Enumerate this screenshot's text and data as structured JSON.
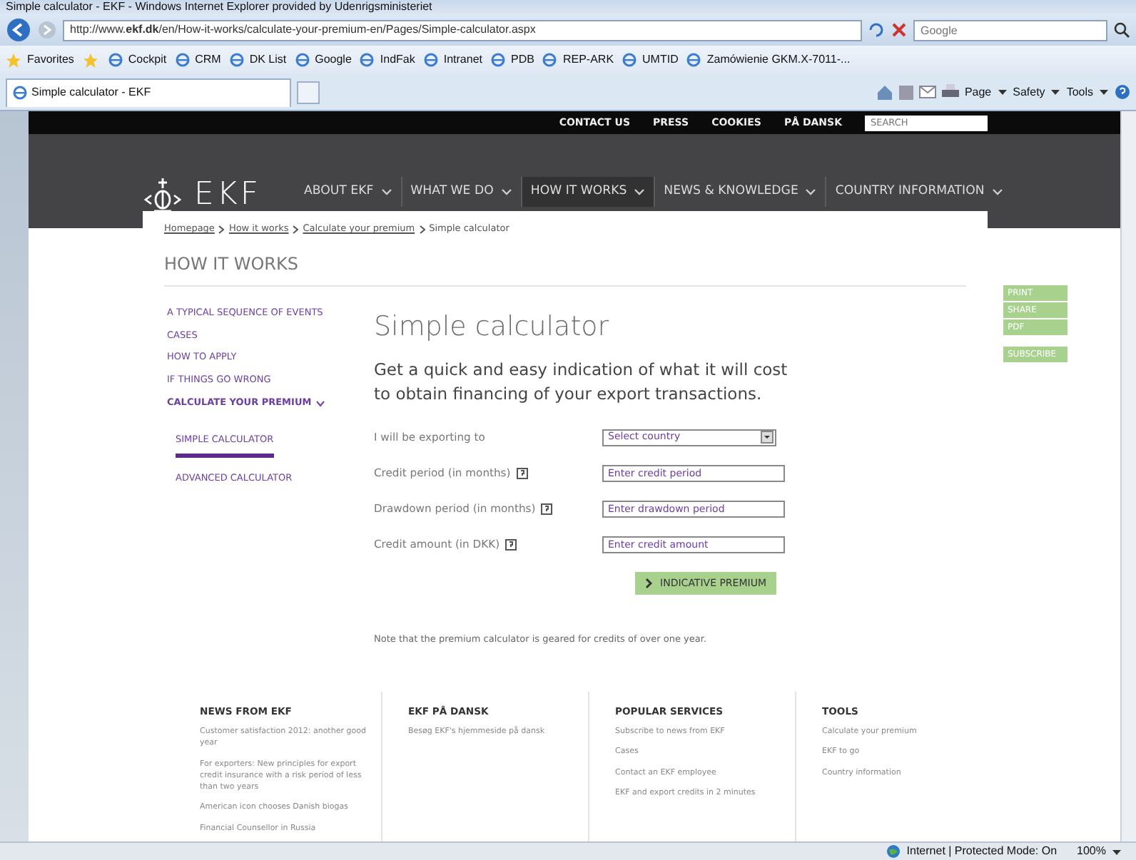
{
  "window": {
    "title": "Simple calculator - EKF - Windows Internet Explorer provided by Udenrigsministeriet"
  },
  "browser": {
    "address": "http://www.**ekf.dk**/en/How-it-works/calculate-your-premium-en/Pages/Simple-calculator.aspx",
    "search_placeholder": "Google",
    "favorites_label": "Favorites",
    "favorites": [
      {
        "label": "Cockpit"
      },
      {
        "label": "CRM"
      },
      {
        "label": "DK List"
      },
      {
        "label": "Google"
      },
      {
        "label": "IndFak"
      },
      {
        "label": "Intranet"
      },
      {
        "label": "PDB"
      },
      {
        "label": "REP-ARK"
      },
      {
        "label": "UMTID"
      },
      {
        "label": "Zamówienie GKM.X-7011-..."
      }
    ],
    "tab_title": "Simple calculator - EKF",
    "commands": [
      "Page",
      "Safety",
      "Tools"
    ]
  },
  "site": {
    "top_links": [
      "CONTACT US",
      "PRESS",
      "COOKIES",
      "PÅ DANSK"
    ],
    "search_placeholder": "SEARCH",
    "logo": "EKF",
    "nav": [
      {
        "label": "ABOUT EKF",
        "selected": false
      },
      {
        "label": "WHAT WE DO",
        "selected": false
      },
      {
        "label": "HOW IT WORKS",
        "selected": true
      },
      {
        "label": "NEWS & KNOWLEDGE",
        "selected": false
      },
      {
        "label": "COUNTRY INFORMATION",
        "selected": false
      }
    ],
    "breadcrumb": [
      {
        "label": "Homepage",
        "link": true
      },
      {
        "label": "How it works",
        "link": true
      },
      {
        "label": "Calculate your premium",
        "link": true
      },
      {
        "label": "Simple calculator",
        "link": false
      }
    ],
    "section_title": "HOW IT WORKS",
    "sidebar": [
      {
        "label": "A TYPICAL SEQUENCE OF EVENTS"
      },
      {
        "label": "CASES"
      },
      {
        "label": "HOW TO APPLY"
      },
      {
        "label": "IF THINGS GO WRONG"
      },
      {
        "label": "CALCULATE YOUR PREMIUM",
        "expanded": true,
        "children": [
          {
            "label": "SIMPLE CALCULATOR",
            "selected": true
          },
          {
            "label": "ADVANCED CALCULATOR",
            "selected": false
          }
        ]
      }
    ],
    "heading": "Simple calculator",
    "intro": "Get a quick and easy indication of what it will cost to obtain financing of your export transactions.",
    "form": [
      {
        "kind": "select",
        "label": "I will be exporting to",
        "value": "Select country",
        "help": false
      },
      {
        "kind": "input",
        "label": "Credit period (in months)",
        "placeholder": "Enter credit period",
        "help": true
      },
      {
        "kind": "input",
        "label": "Drawdown period (in months)",
        "placeholder": "Enter drawdown period",
        "help": true
      },
      {
        "kind": "input",
        "label": "Credit amount (in DKK)",
        "placeholder": "Enter credit amount",
        "help": true
      }
    ],
    "submit": "INDICATIVE PREMIUM",
    "note": "Note that the premium calculator is geared for credits of over one year.",
    "side_actions": [
      "PRINT",
      "SHARE",
      "PDF"
    ],
    "subscribe": "SUBSCRIBE",
    "footer": [
      {
        "title": "NEWS FROM EKF",
        "links": [
          "Customer satisfaction 2012: another good year",
          "For exporters: New principles for export credit insurance with a risk period of less than two years",
          "American icon chooses Danish biogas",
          "Financial Counsellor in Russia"
        ]
      },
      {
        "title": "EKF PÅ DANSK",
        "links": [
          "Besøg EKF's hjemmeside på dansk"
        ]
      },
      {
        "title": "POPULAR SERVICES",
        "links": [
          "Subscribe to news from EKF",
          "Cases",
          "Contact an EKF employee",
          "EKF and export credits in 2 minutes"
        ]
      },
      {
        "title": "TOOLS",
        "links": [
          "Calculate your premium",
          "EKF to go",
          "Country information"
        ]
      }
    ]
  },
  "status": {
    "zone": "Internet | Protected Mode: On",
    "zoom": "100%"
  }
}
